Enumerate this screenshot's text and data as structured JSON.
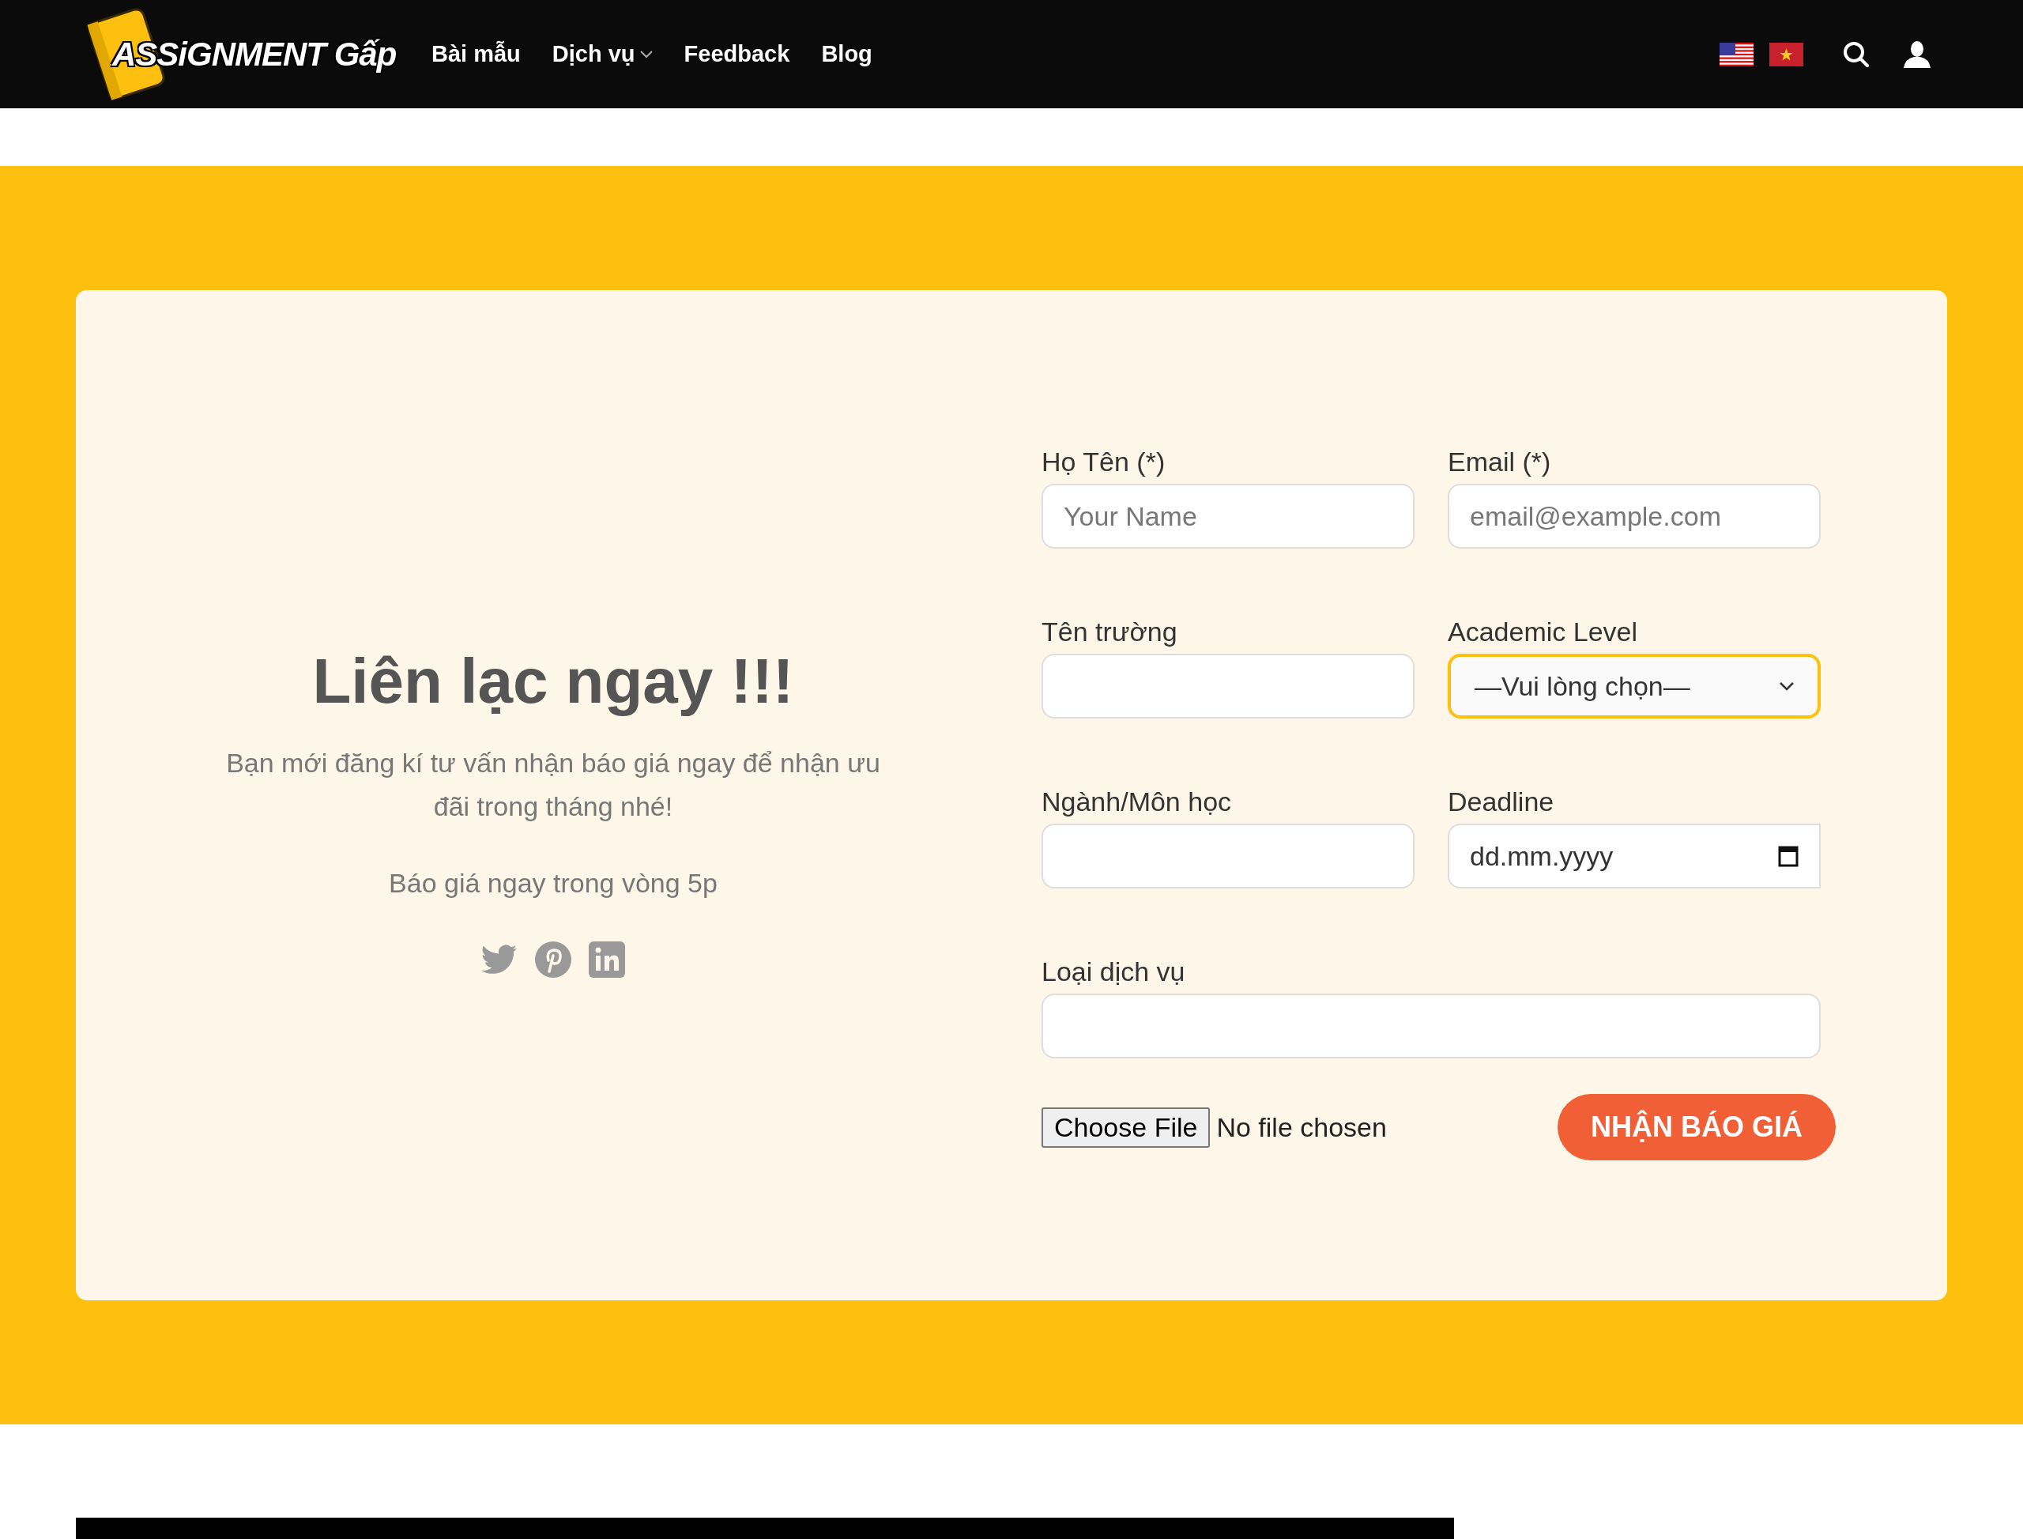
{
  "header": {
    "logo": "ASSiGNMENT Gấp",
    "nav": [
      {
        "label": "Bài mẫu",
        "has_dropdown": false
      },
      {
        "label": "Dịch vụ",
        "has_dropdown": true
      },
      {
        "label": "Feedback",
        "has_dropdown": false
      },
      {
        "label": "Blog",
        "has_dropdown": false
      }
    ]
  },
  "contact": {
    "heading": "Liên lạc ngay !!!",
    "intro": "Bạn mới đăng kí tư vấn nhận báo giá ngay để nhận ưu đãi trong tháng nhé!",
    "note": "Báo giá ngay trong vòng 5p"
  },
  "form": {
    "fields": [
      {
        "kind": "text",
        "label": "Họ Tên (*)",
        "placeholder": "Your Name",
        "wide": false,
        "focused": false
      },
      {
        "kind": "text",
        "label": "Email (*)",
        "placeholder": "email@example.com",
        "wide": false,
        "focused": false
      },
      {
        "kind": "text",
        "label": "Tên trường",
        "wide": false,
        "focused": false
      },
      {
        "kind": "select",
        "label": "Academic Level",
        "value": "—Vui lòng chọn—",
        "wide": false,
        "focused": true
      },
      {
        "kind": "text",
        "label": "Ngành/Môn học",
        "wide": false,
        "focused": false
      },
      {
        "kind": "date",
        "label": "Deadline",
        "value": "dd.mm.yyyy",
        "wide": false,
        "focused": false
      },
      {
        "kind": "text",
        "label": "Loại dịch vụ",
        "wide": true,
        "focused": false
      }
    ],
    "file_button": "Choose File",
    "file_status": "No file chosen",
    "submit": "NHẬN BÁO GIÁ"
  }
}
